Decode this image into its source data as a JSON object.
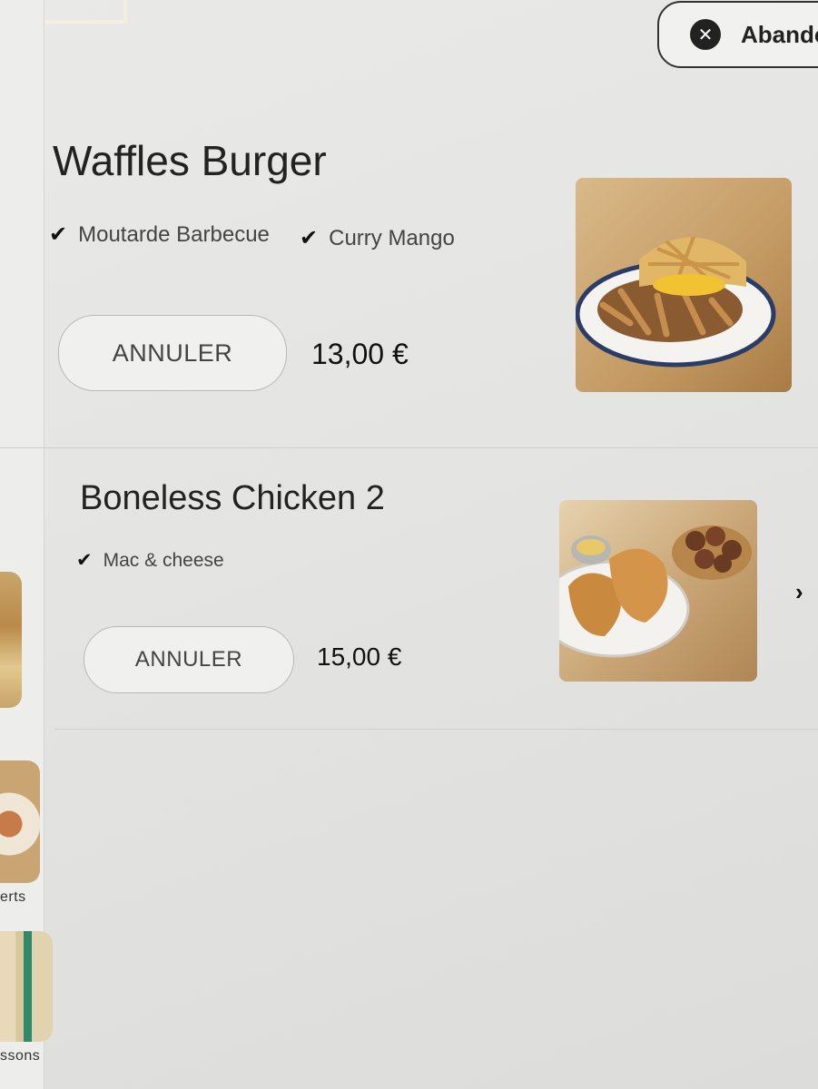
{
  "header": {
    "abandon_label": "Abando",
    "abandon_icon": "close-icon"
  },
  "sidebar": {
    "items": [
      {
        "label": "erts",
        "icon": "dessert-thumbnail"
      },
      {
        "label": "ssons",
        "icon": "drinks-thumbnail"
      }
    ]
  },
  "cart": {
    "items": [
      {
        "name": "Waffles Burger",
        "options": [
          "Moutarde Barbecue",
          "Curry Mango"
        ],
        "cancel_label": "ANNULER",
        "price": "13,00 €",
        "image": "waffles-burger-photo"
      },
      {
        "name": "Boneless Chicken 2",
        "options": [
          "Mac & cheese"
        ],
        "cancel_label": "ANNULER",
        "price": "15,00 €",
        "image": "boneless-chicken-photo"
      }
    ]
  },
  "colors": {
    "background": "#e6e6e4",
    "text": "#222222",
    "button_border": "#b8b8b6"
  }
}
